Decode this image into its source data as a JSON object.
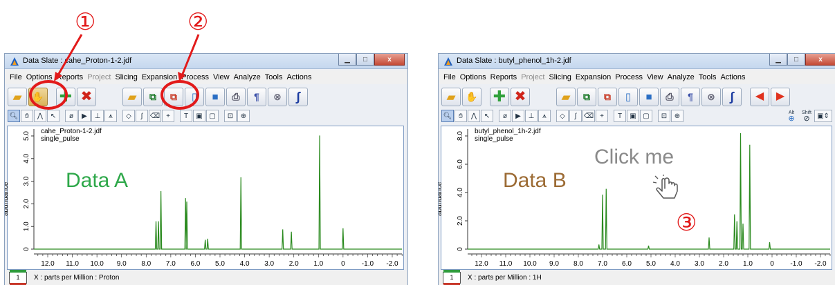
{
  "windowA": {
    "title": "Data Slate : cahe_Proton-1-2.jdf",
    "menu": [
      "File",
      "Options",
      "Reports",
      "Project",
      "Slicing",
      "Expansion",
      "Process",
      "View",
      "Analyze",
      "Tools",
      "Actions"
    ],
    "disabled_menu": "Project",
    "file_label": "cahe_Proton-1-2.jdf",
    "pulse_label": "single_pulse",
    "y_axis_label": "abundance",
    "y_ticks": [
      "5.0",
      "4.0",
      "3.0",
      "2.0",
      "1.0",
      "0"
    ],
    "x_ticks": [
      "12.0",
      "11.0",
      "10.0",
      "9.0",
      "8.0",
      "7.0",
      "6.0",
      "5.0",
      "4.0",
      "3.0",
      "2.0",
      "1.0",
      "0",
      "-1.0",
      "-2.0"
    ],
    "status_page": "1",
    "status_text": "X : parts per Million : Proton",
    "data_label": "Data A",
    "data_label_color": "#2ea84a"
  },
  "windowB": {
    "title": "Data Slate : butyl_phenol_1h-2.jdf",
    "menu": [
      "File",
      "Options",
      "Reports",
      "Project",
      "Slicing",
      "Expansion",
      "Process",
      "View",
      "Analyze",
      "Tools",
      "Actions"
    ],
    "disabled_menu": "Project",
    "file_label": "butyl_phenol_1h-2.jdf",
    "pulse_label": "single_pulse",
    "y_axis_label": "abundance",
    "y_ticks": [
      "8.0",
      "6.0",
      "4.0",
      "2.0",
      "0"
    ],
    "x_ticks": [
      "12.0",
      "11.0",
      "10.0",
      "9.0",
      "8.0",
      "7.0",
      "6.0",
      "5.0",
      "4.0",
      "3.0",
      "2.0",
      "1.0",
      "0",
      "-1.0",
      "-2.0"
    ],
    "status_page": "1",
    "status_text": "X : parts per Million : 1H",
    "data_label": "Data B",
    "data_label_color": "#9c6b34",
    "hint_text": "Click me"
  },
  "annotations": {
    "one": "①",
    "two": "②",
    "three": "③",
    "color": "#e21a1a"
  },
  "modifier_labels": {
    "alt": "Alt",
    "shift": "Shift"
  },
  "spectrum_color": "#2a8a1e"
}
